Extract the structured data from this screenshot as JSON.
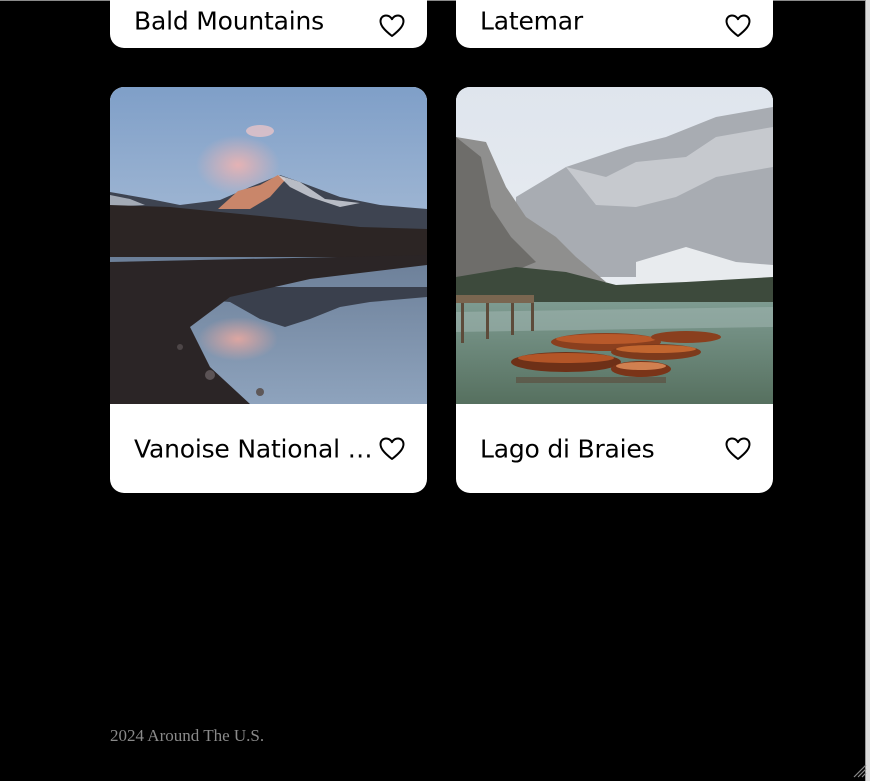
{
  "cards": [
    {
      "title": "Bald Mountains",
      "like_icon": "heart-outline-icon"
    },
    {
      "title": "Latemar",
      "like_icon": "heart-outline-icon"
    },
    {
      "title": "Vanoise National Park",
      "image": "mountain-lake-reflection-at-dusk",
      "like_icon": "heart-outline-icon"
    },
    {
      "title": "Lago di Braies",
      "image": "alpine-lake-with-wooden-rowboats-and-dock",
      "like_icon": "heart-outline-icon"
    }
  ],
  "footer": {
    "copyright": "2024 Around The U.S."
  },
  "colors": {
    "page_background": "#000000",
    "card_background": "#FFFFFF",
    "footer_text": "#8A8A8A"
  }
}
